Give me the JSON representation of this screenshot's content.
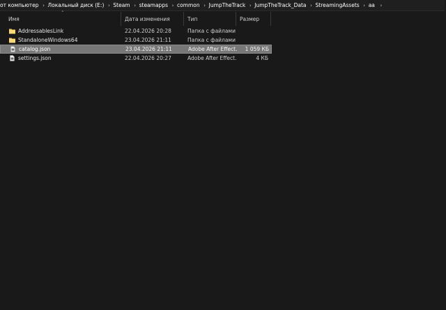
{
  "breadcrumb": [
    "от компьютер",
    "Локальный диск (E:)",
    "Steam",
    "steamapps",
    "common",
    "JumpTheTrack",
    "JumpTheTrack_Data",
    "StreamingAssets",
    "aa"
  ],
  "columns": {
    "name": "Имя",
    "date": "Дата изменения",
    "type": "Тип",
    "size": "Размер"
  },
  "files": [
    {
      "name": "AddressablesLink",
      "date": "22.04.2026 20:28",
      "type": "Папка с файлами",
      "size": "",
      "icon": "folder-icon",
      "selected": false
    },
    {
      "name": "StandaloneWindows64",
      "date": "23.04.2026 21:11",
      "type": "Папка с файлами",
      "size": "",
      "icon": "folder-icon",
      "selected": false
    },
    {
      "name": "catalog.json",
      "date": "23.04.2026 21:11",
      "type": "Adobe After Effect...",
      "size": "1 059 КБ",
      "icon": "json-file-icon",
      "selected": true
    },
    {
      "name": "settings.json",
      "date": "22.04.2026 20:27",
      "type": "Adobe After Effect...",
      "size": "4 КБ",
      "icon": "json-file-icon",
      "selected": false
    }
  ],
  "colors": {
    "background": "#191919",
    "selection": "#777777",
    "folder": "#f3c955"
  }
}
